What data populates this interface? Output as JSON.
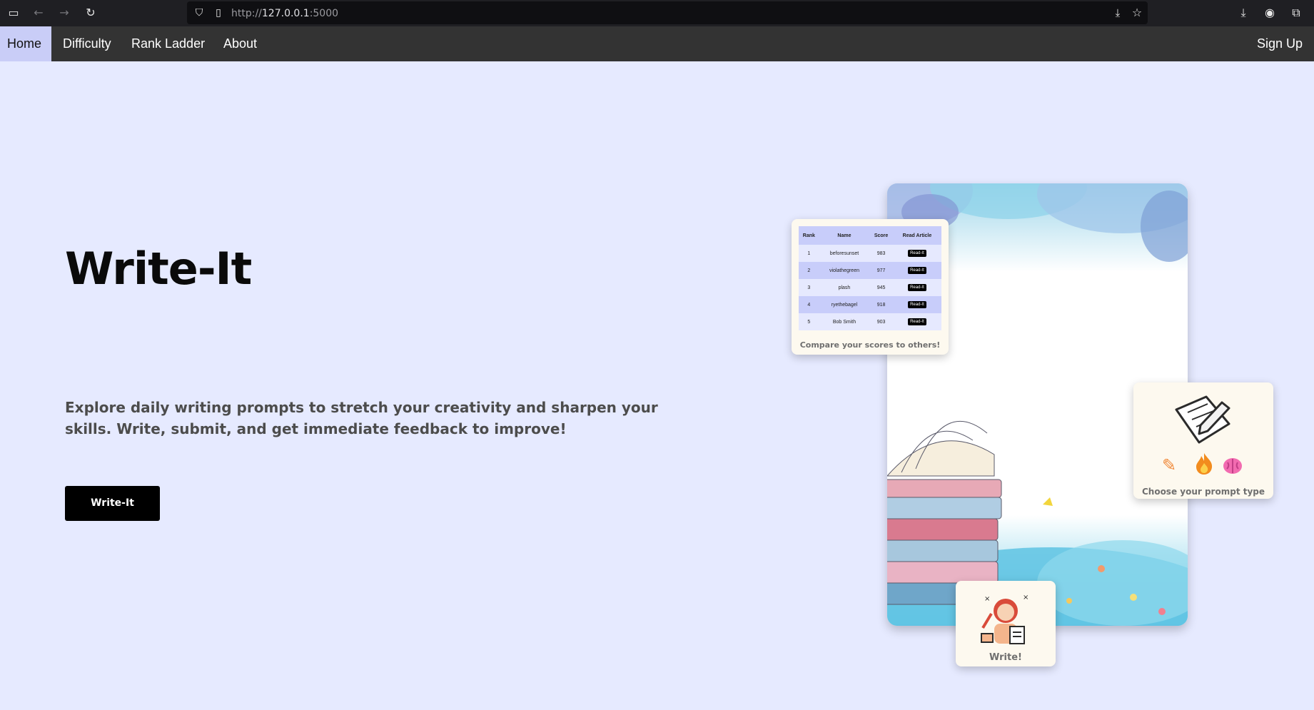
{
  "browser": {
    "url_scheme": "http://",
    "url_host": "127.0.0.1",
    "url_port": ":5000"
  },
  "nav": {
    "home": "Home",
    "difficulty": "Difficulty",
    "rank_ladder": "Rank Ladder",
    "about": "About",
    "sign_up": "Sign Up"
  },
  "hero": {
    "title": "Write-It",
    "description": "Explore daily writing prompts to stretch your creativity and sharpen your skills. Write, submit, and get immediate feedback to improve!",
    "button": "Write-It"
  },
  "ladder_card": {
    "headers": [
      "Rank",
      "Name",
      "Score",
      "Read Article"
    ],
    "rows": [
      {
        "rank": "1",
        "name": "beforesunset",
        "score": "983",
        "action": "Read-It"
      },
      {
        "rank": "2",
        "name": "violathegreen",
        "score": "977",
        "action": "Read-It"
      },
      {
        "rank": "3",
        "name": "plash",
        "score": "945",
        "action": "Read-It"
      },
      {
        "rank": "4",
        "name": "ryethebagel",
        "score": "918",
        "action": "Read-It"
      },
      {
        "rank": "5",
        "name": "Bob Smith",
        "score": "903",
        "action": "Read-It"
      }
    ],
    "caption": "Compare your scores to others!"
  },
  "prompt_card": {
    "caption": "Choose your prompt type",
    "icons": [
      "pencil-icon",
      "fire-icon",
      "brain-icon"
    ]
  },
  "write_card": {
    "caption": "Write!"
  },
  "colors": {
    "page_bg": "#e6eaff",
    "nav_bg": "#333333",
    "nav_active": "#c9cdf7",
    "button_bg": "#000000",
    "card_bg": "#fdf9ef"
  }
}
